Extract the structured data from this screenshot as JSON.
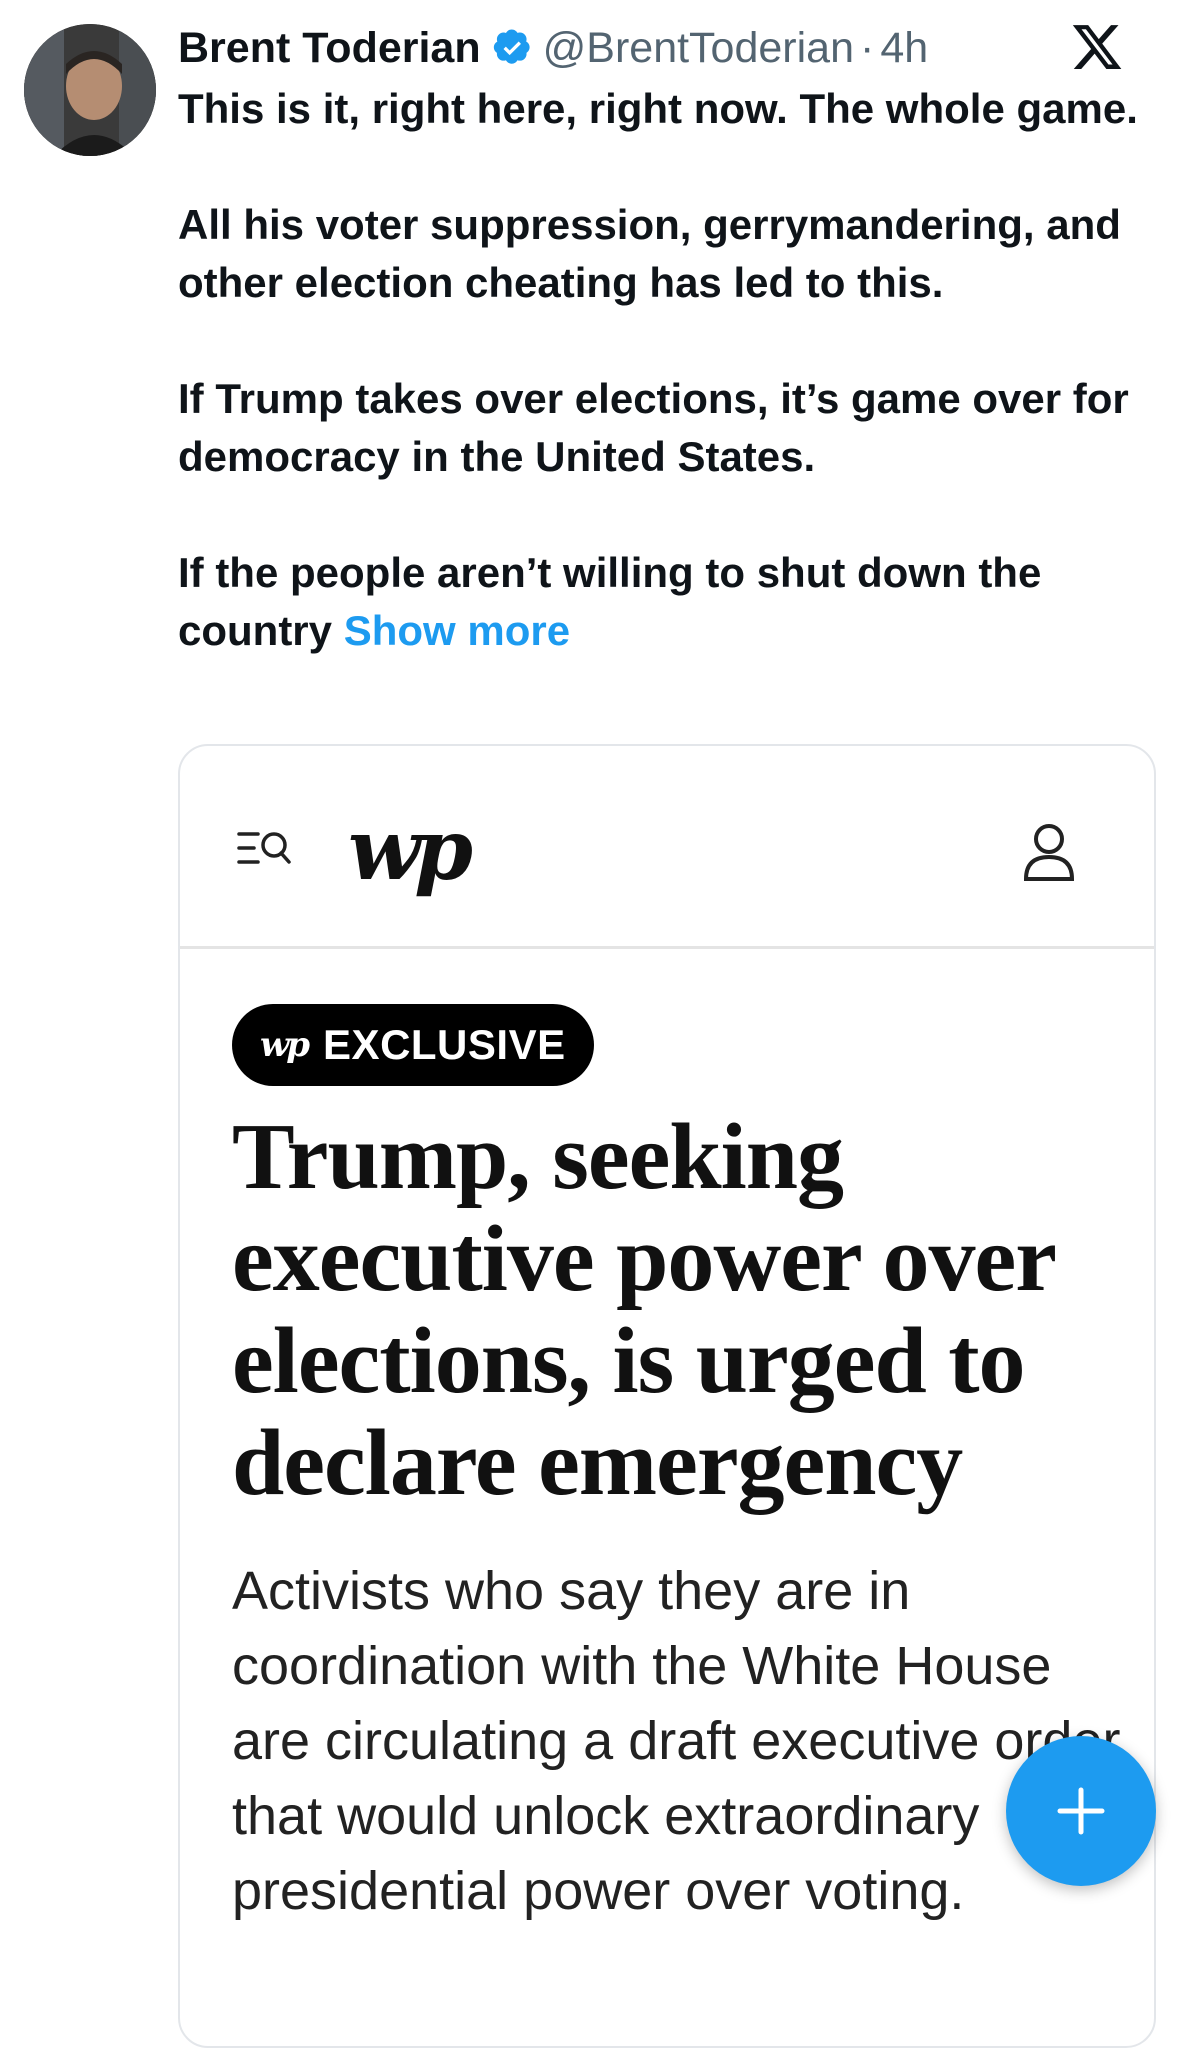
{
  "tweet": {
    "author_name": "Brent Toderian",
    "handle": "@BrentToderian",
    "separator": "·",
    "time": "4h",
    "paragraphs": [
      "This is it, right here, right now. The whole game.",
      "All his voter suppression, gerrymandering, and other election cheating has led to this.",
      "If Trump takes over elections, it’s game over for democracy in the United States."
    ],
    "last_paragraph": "If the people aren’t willing to shut down the country",
    "show_more": "Show more",
    "verified_icon": "verified-badge-icon",
    "platform_icon": "x-logo-icon",
    "accent_color": "#1d9bf0"
  },
  "card": {
    "logo": "wp",
    "badge_logo": "wp",
    "badge_label": "EXCLUSIVE",
    "headline": "Trump, seeking executive power over elections, is urged to declare emergency",
    "deck": "Activists who say they are in coordination with the White House are circulating a draft executive order that would unlock extraordinary presidential power over voting.",
    "icons": [
      "menu-search-icon",
      "account-icon"
    ]
  },
  "compose": {
    "icon": "plus-icon"
  }
}
